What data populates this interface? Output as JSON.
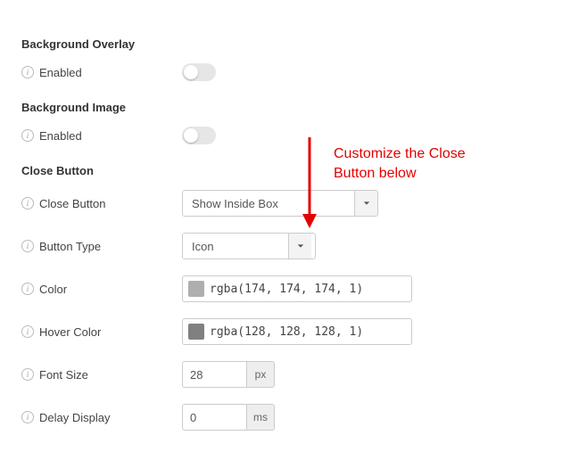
{
  "sections": [
    {
      "heading": "Background Overlay"
    },
    {
      "heading": "Background Image"
    },
    {
      "heading": "Close Button"
    }
  ],
  "overlay": {
    "enabled_label": "Enabled"
  },
  "bgimage": {
    "enabled_label": "Enabled"
  },
  "closebtn": {
    "close_button_label": "Close Button",
    "close_button_value": "Show Inside Box",
    "button_type_label": "Button Type",
    "button_type_value": "Icon",
    "color_label": "Color",
    "color_value": "rgba(174, 174, 174, 1)",
    "color_swatch": "#aeaeae",
    "hover_color_label": "Hover Color",
    "hover_color_value": "rgba(128, 128, 128, 1)",
    "hover_color_swatch": "#808080",
    "font_size_label": "Font Size",
    "font_size_value": "28",
    "font_size_unit": "px",
    "delay_label": "Delay Display",
    "delay_value": "0",
    "delay_unit": "ms"
  },
  "annotation": {
    "text": "Customize the Close Button below"
  }
}
